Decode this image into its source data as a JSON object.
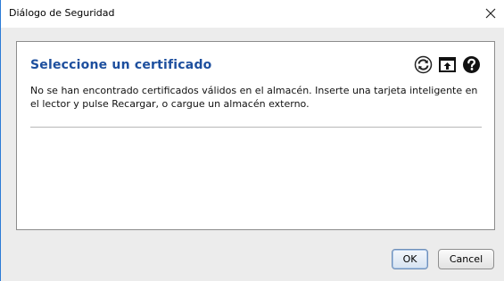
{
  "window": {
    "title": "Diálogo de Seguridad",
    "close_icon": "close-icon"
  },
  "panel": {
    "heading": "Seleccione un certificado",
    "message": "No se han encontrado certificados válidos en el almacén. Inserte una tarjeta inteligente en el lector y pulse Recargar, o cargue un almacén externo.",
    "icons": [
      "reload-icon",
      "open-store-icon",
      "help-icon"
    ]
  },
  "buttons": {
    "ok_label": "OK",
    "cancel_label": "Cancel"
  },
  "colors": {
    "heading": "#1d4f9e",
    "window_border": "#2b7bd6",
    "background": "#ececec"
  }
}
